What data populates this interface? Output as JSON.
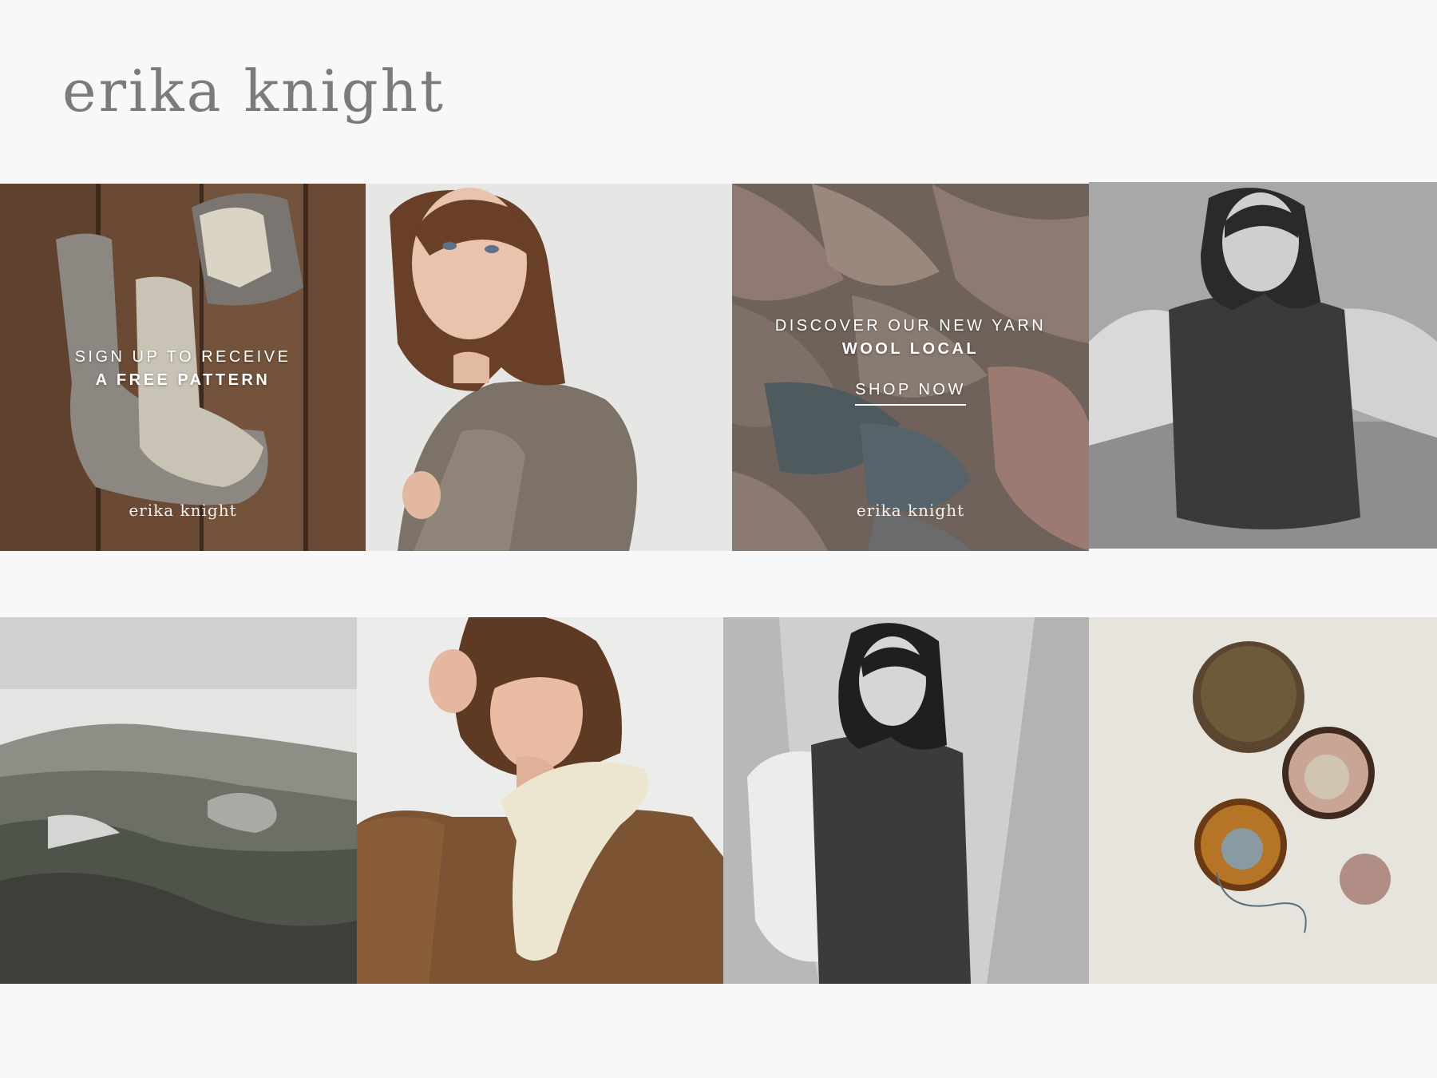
{
  "brand": {
    "logo": "erika knight"
  },
  "tiles": {
    "socks": {
      "line1": "SIGN UP TO RECEIVE",
      "line2": "A FREE PATTERN",
      "watermark": "erika knight"
    },
    "yarn": {
      "line1": "DISCOVER OUR NEW YARN",
      "line2": "WOOL LOCAL",
      "cta": "SHOP NOW",
      "watermark": "erika knight"
    }
  },
  "colors": {
    "background": "#f8f8f8",
    "logo": "#7b7b7b",
    "overlay_text": "#ffffff"
  }
}
